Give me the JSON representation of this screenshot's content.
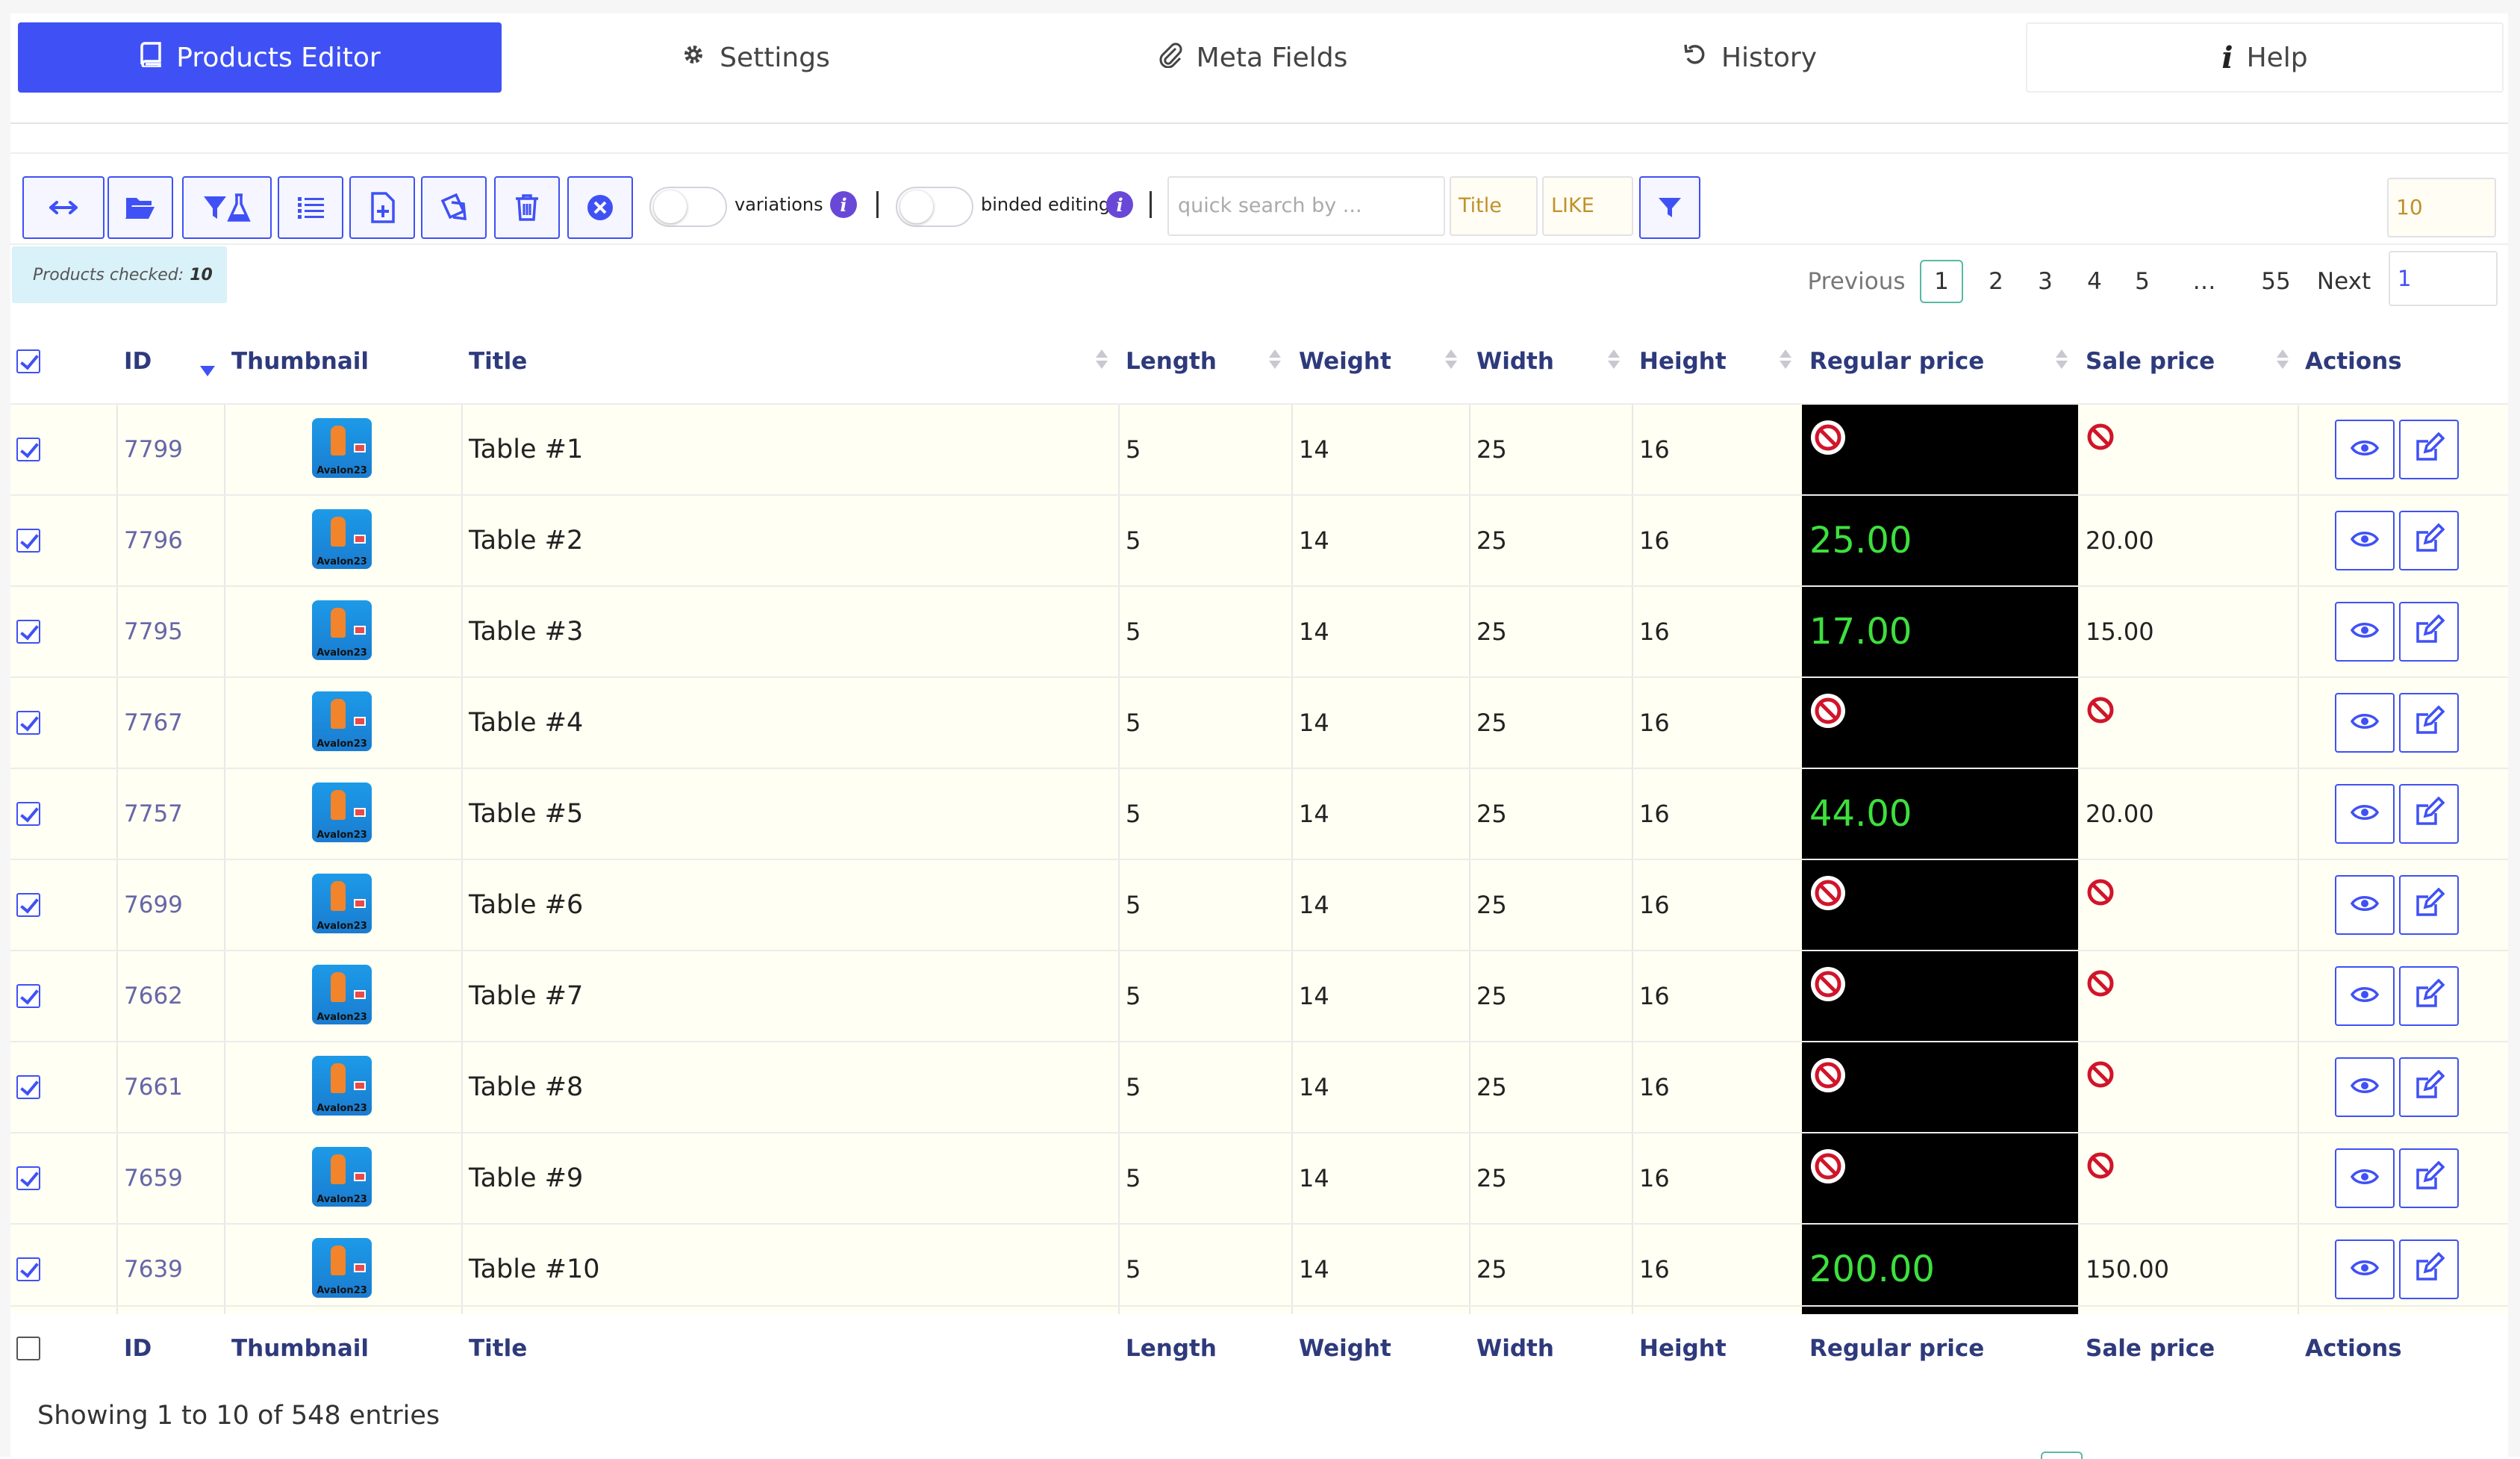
{
  "tabs": [
    {
      "label": "Products Editor",
      "icon": "book-icon"
    },
    {
      "label": "Settings",
      "icon": "gear-icon"
    },
    {
      "label": "Meta Fields",
      "icon": "paperclip-icon"
    },
    {
      "label": "History",
      "icon": "undo-icon"
    },
    {
      "label": "Help",
      "icon": "info-icon"
    }
  ],
  "toolbar": {
    "variations_label": "variations",
    "binded_label": "binded editing",
    "search_placeholder": "quick search by ...",
    "search_field": "Title",
    "search_operator": "LIKE",
    "per_page": "10",
    "buttons": [
      "arrows-horizontal-icon",
      "folder-open-icon",
      "filter-flask-icon",
      "list-icon",
      "file-plus-icon",
      "clone-icon",
      "trash-icon",
      "close-circle-icon"
    ]
  },
  "checked": {
    "label": "Products checked:",
    "count": "10"
  },
  "pagination": {
    "previous": "Previous",
    "pages": [
      "1",
      "2",
      "3",
      "4",
      "5",
      "…",
      "55"
    ],
    "current": "1",
    "next": "Next",
    "jump_value": "1"
  },
  "columns": {
    "id": "ID",
    "thumbnail": "Thumbnail",
    "title": "Title",
    "length": "Length",
    "weight": "Weight",
    "width": "Width",
    "height": "Height",
    "regular_price": "Regular price",
    "sale_price": "Sale price",
    "actions": "Actions"
  },
  "thumbnail_text": "Avalon23",
  "colors": {
    "accent": "#3f51f5",
    "price_bg": "#000000",
    "price_text": "#3ee03e",
    "row_bg": "#fffff3",
    "ban": "#d0152a"
  },
  "rows": [
    {
      "id": "7799",
      "title": "Table #1",
      "length": "5",
      "weight": "14",
      "width": "25",
      "height": "16",
      "regular_price": "",
      "sale_price": ""
    },
    {
      "id": "7796",
      "title": "Table #2",
      "length": "5",
      "weight": "14",
      "width": "25",
      "height": "16",
      "regular_price": "25.00",
      "sale_price": "20.00"
    },
    {
      "id": "7795",
      "title": "Table #3",
      "length": "5",
      "weight": "14",
      "width": "25",
      "height": "16",
      "regular_price": "17.00",
      "sale_price": "15.00"
    },
    {
      "id": "7767",
      "title": "Table #4",
      "length": "5",
      "weight": "14",
      "width": "25",
      "height": "16",
      "regular_price": "",
      "sale_price": ""
    },
    {
      "id": "7757",
      "title": "Table #5",
      "length": "5",
      "weight": "14",
      "width": "25",
      "height": "16",
      "regular_price": "44.00",
      "sale_price": "20.00"
    },
    {
      "id": "7699",
      "title": "Table #6",
      "length": "5",
      "weight": "14",
      "width": "25",
      "height": "16",
      "regular_price": "",
      "sale_price": ""
    },
    {
      "id": "7662",
      "title": "Table #7",
      "length": "5",
      "weight": "14",
      "width": "25",
      "height": "16",
      "regular_price": "",
      "sale_price": ""
    },
    {
      "id": "7661",
      "title": "Table #8",
      "length": "5",
      "weight": "14",
      "width": "25",
      "height": "16",
      "regular_price": "",
      "sale_price": ""
    },
    {
      "id": "7659",
      "title": "Table #9",
      "length": "5",
      "weight": "14",
      "width": "25",
      "height": "16",
      "regular_price": "",
      "sale_price": ""
    },
    {
      "id": "7639",
      "title": "Table #10",
      "length": "5",
      "weight": "14",
      "width": "25",
      "height": "16",
      "regular_price": "200.00",
      "sale_price": "150.00"
    }
  ],
  "footer": {
    "showing": "Showing 1 to 10 of 548 entries"
  }
}
